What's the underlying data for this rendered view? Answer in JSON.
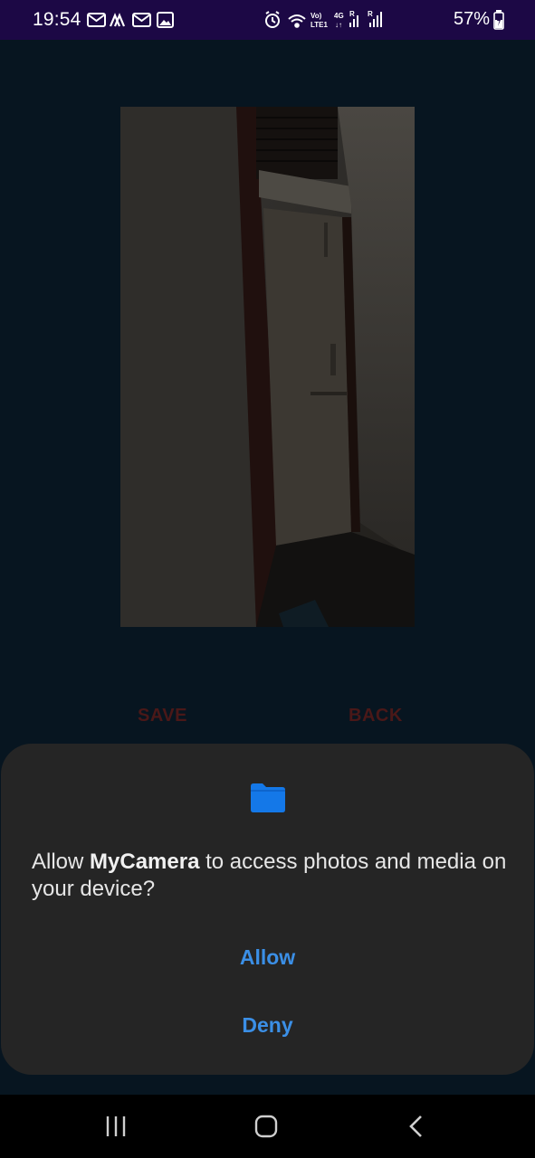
{
  "status_bar": {
    "time": "19:54",
    "battery_percent": "57%",
    "left_icons": [
      "gmail-icon",
      "drive-icon",
      "gmail-icon",
      "gallery-icon"
    ],
    "right_icons": [
      "alarm-icon",
      "wifi-icon",
      "volte-icon",
      "signal-4g-icon",
      "signal-icon",
      "battery-icon"
    ]
  },
  "main": {
    "save_label": "SAVE",
    "back_label": "BACK",
    "button_color": "#4a1818"
  },
  "permission_dialog": {
    "icon": "folder-icon",
    "message_prefix": "Allow ",
    "app_name": "MyCamera",
    "message_suffix": " to access photos and media on your device?",
    "allow_label": "Allow",
    "deny_label": "Deny",
    "accent_color": "#3b8fe6"
  },
  "nav_bar": {
    "recent": "recent-apps-icon",
    "home": "home-icon",
    "back": "back-icon"
  }
}
